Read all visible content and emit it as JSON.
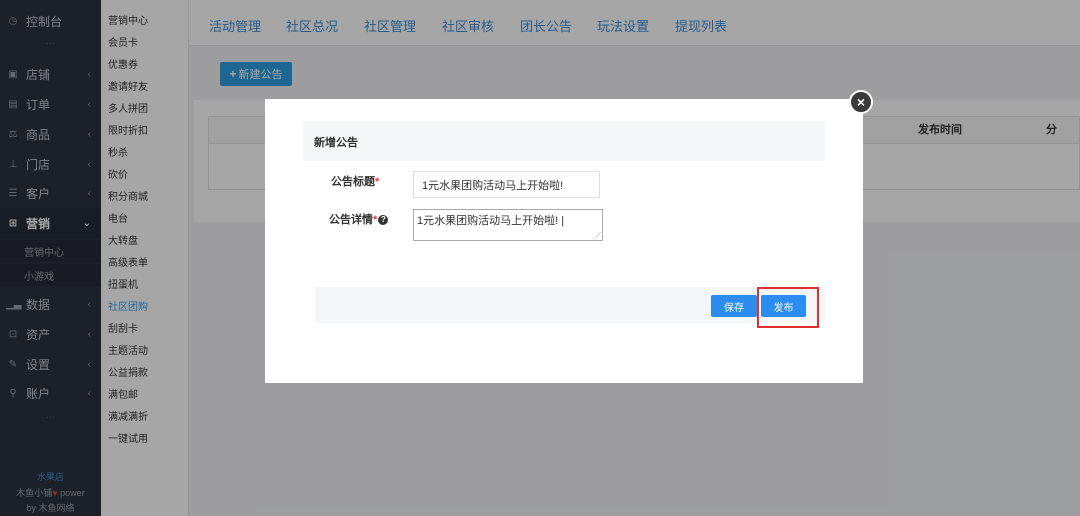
{
  "left_nav": {
    "items": [
      {
        "label": "控制台",
        "icon": "dashboard-icon"
      },
      {
        "label": "店铺",
        "icon": "shop-icon"
      },
      {
        "label": "订单",
        "icon": "order-icon"
      },
      {
        "label": "商品",
        "icon": "goods-icon"
      },
      {
        "label": "门店",
        "icon": "store-icon"
      },
      {
        "label": "客户",
        "icon": "customer-icon"
      },
      {
        "label": "营销",
        "icon": "marketing-icon"
      },
      {
        "label": "数据",
        "icon": "data-icon"
      },
      {
        "label": "资产",
        "icon": "asset-icon"
      },
      {
        "label": "设置",
        "icon": "settings-icon"
      },
      {
        "label": "账户",
        "icon": "account-icon"
      }
    ],
    "sub_items": [
      "营销中心",
      "小游戏"
    ],
    "footer": {
      "brand": "水果店",
      "line1": "木鱼小铺",
      "line1b": "power",
      "line2": "by 木鱼网络"
    }
  },
  "secondary_nav": {
    "items": [
      "营销中心",
      "会员卡",
      "优惠券",
      "邀请好友",
      "多人拼团",
      "限时折扣",
      "秒杀",
      "砍价",
      "积分商城",
      "电台",
      "大转盘",
      "高级表单",
      "扭蛋机",
      "社区团购",
      "刮刮卡",
      "主题活动",
      "公益捐款",
      "满包邮",
      "满减满折",
      "一键试用"
    ],
    "active": "社区团购"
  },
  "tabs": [
    "活动管理",
    "社区总况",
    "社区管理",
    "社区审核",
    "团长公告",
    "玩法设置",
    "提现列表"
  ],
  "main": {
    "new_button": "新建公告",
    "table_headers": {
      "publish_time": "发布时间",
      "more": "分"
    }
  },
  "modal": {
    "title": "新增公告",
    "title_label": "公告标题",
    "title_value": "1元水果团购活动马上开始啦!",
    "detail_label": "公告详情",
    "detail_value": "1元水果团购活动马上开始啦! |",
    "save_button": "保存",
    "publish_button": "发布"
  },
  "colors": {
    "nav_bg": "#2c3340",
    "accent": "#2d8cf0",
    "tab_text": "#3b8ed8",
    "highlight": "#e03030"
  }
}
